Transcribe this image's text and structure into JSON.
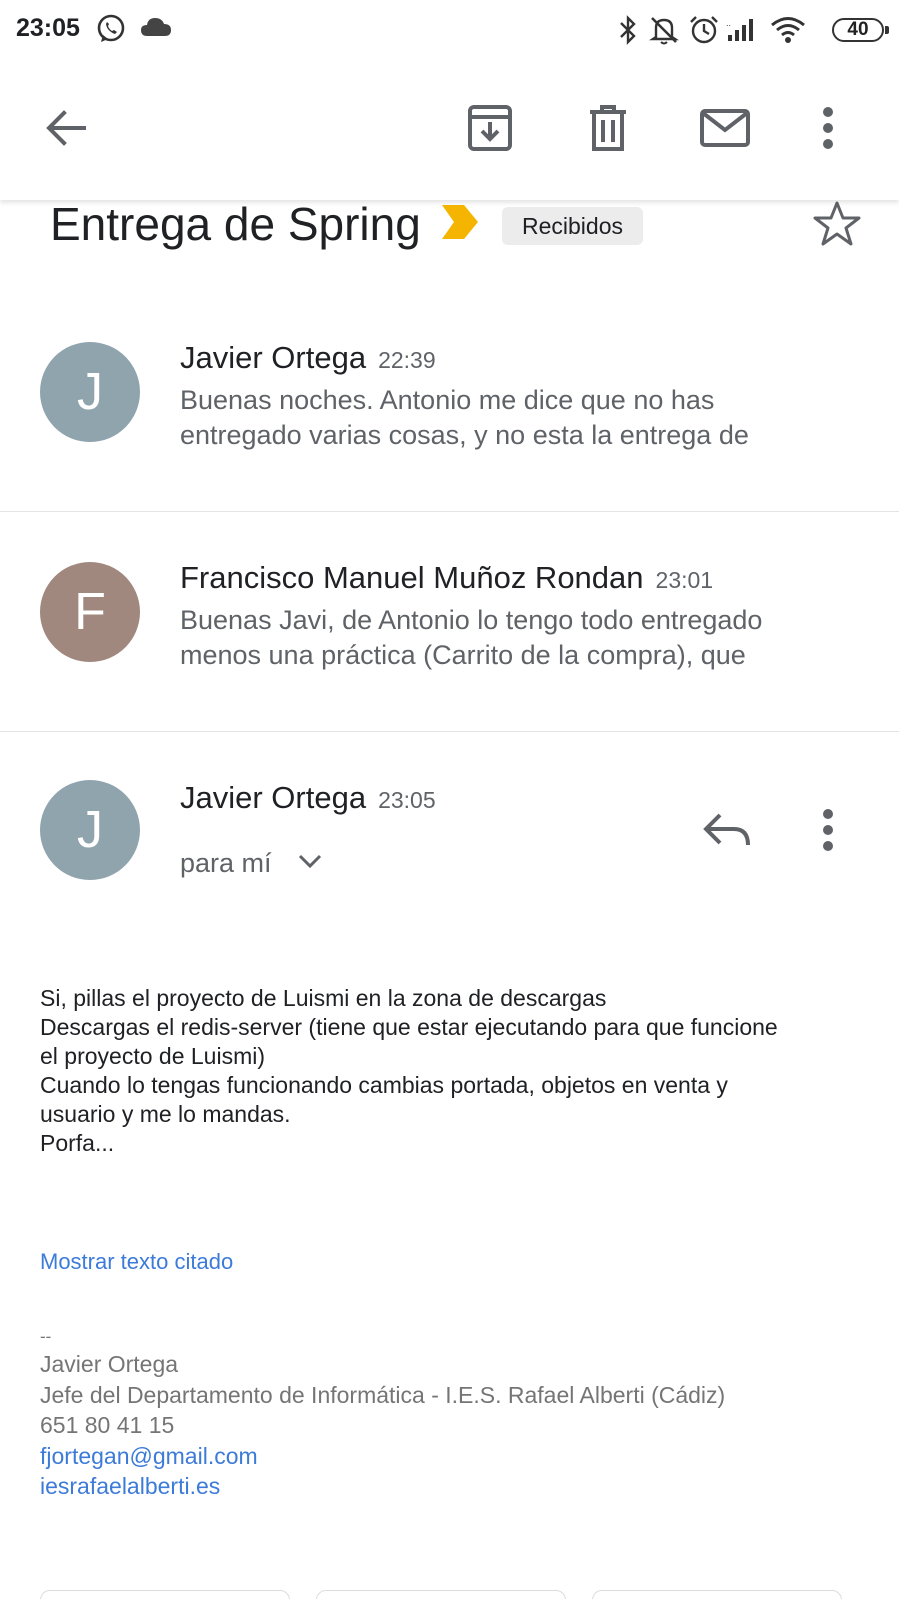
{
  "status_bar": {
    "time": "23:05",
    "battery": "40",
    "icons": [
      "whatsapp-icon",
      "cloud-icon",
      "bluetooth-icon",
      "mute-icon",
      "alarm-icon",
      "signal-icon",
      "wifi-icon",
      "battery-icon"
    ]
  },
  "toolbar": {
    "icons": [
      "back-arrow-icon",
      "archive-icon",
      "delete-icon",
      "mark-unread-icon",
      "more-vert-icon"
    ]
  },
  "subject": {
    "title": "Entrega de Spring",
    "label": "Recibidos",
    "importance_color": "#f4b400"
  },
  "messages": [
    {
      "initial": "J",
      "sender": "Javier Ortega",
      "time": "22:39",
      "snippet_line1": "Buenas noches. Antonio me dice que no has",
      "snippet_line2": "entregado varias cosas, y no esta la entrega de",
      "avatar_color": "#90a4ae"
    },
    {
      "initial": "F",
      "sender": "Francisco Manuel Muñoz Rondan",
      "time": "23:01",
      "snippet_line1": "Buenas Javi, de Antonio lo tengo todo entregado",
      "snippet_line2": "menos una práctica (Carrito de la compra), que",
      "avatar_color": "#a1887f"
    },
    {
      "initial": "J",
      "sender": "Javier Ortega",
      "time": "23:05",
      "recipient": "para mí",
      "avatar_color": "#90a4ae",
      "body": [
        "Si, pillas el proyecto de Luismi en la zona de descargas",
        "Descargas el redis-server (tiene que estar ejecutando para que funcione",
        "el proyecto de Luismi)",
        "Cuando lo tengas funcionando cambias portada, objetos en venta y",
        "usuario y me lo mandas.",
        "Porfa..."
      ],
      "show_quoted": "Mostrar texto citado",
      "signature": {
        "separator": "--",
        "name": "Javier Ortega",
        "role": "Jefe del Departamento de Informática - I.E.S. Rafael Alberti (Cádiz)",
        "phone": "651 80 41 15",
        "email": "fjortegan@gmail.com",
        "website": "iesrafaelalberti.es"
      }
    }
  ]
}
